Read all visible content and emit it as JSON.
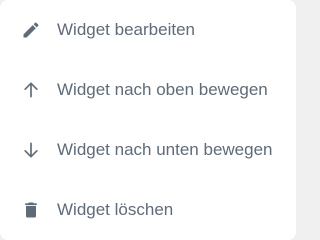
{
  "menu": {
    "items": [
      {
        "label": "Widget bearbeiten",
        "icon": "pencil-icon"
      },
      {
        "label": "Widget nach oben bewegen",
        "icon": "arrow-up-icon"
      },
      {
        "label": "Widget nach unten bewegen",
        "icon": "arrow-down-icon"
      },
      {
        "label": "Widget löschen",
        "icon": "trash-icon"
      }
    ]
  },
  "colors": {
    "text": "#5f6b78",
    "icon": "#5f6b78",
    "background": "#ffffff"
  }
}
